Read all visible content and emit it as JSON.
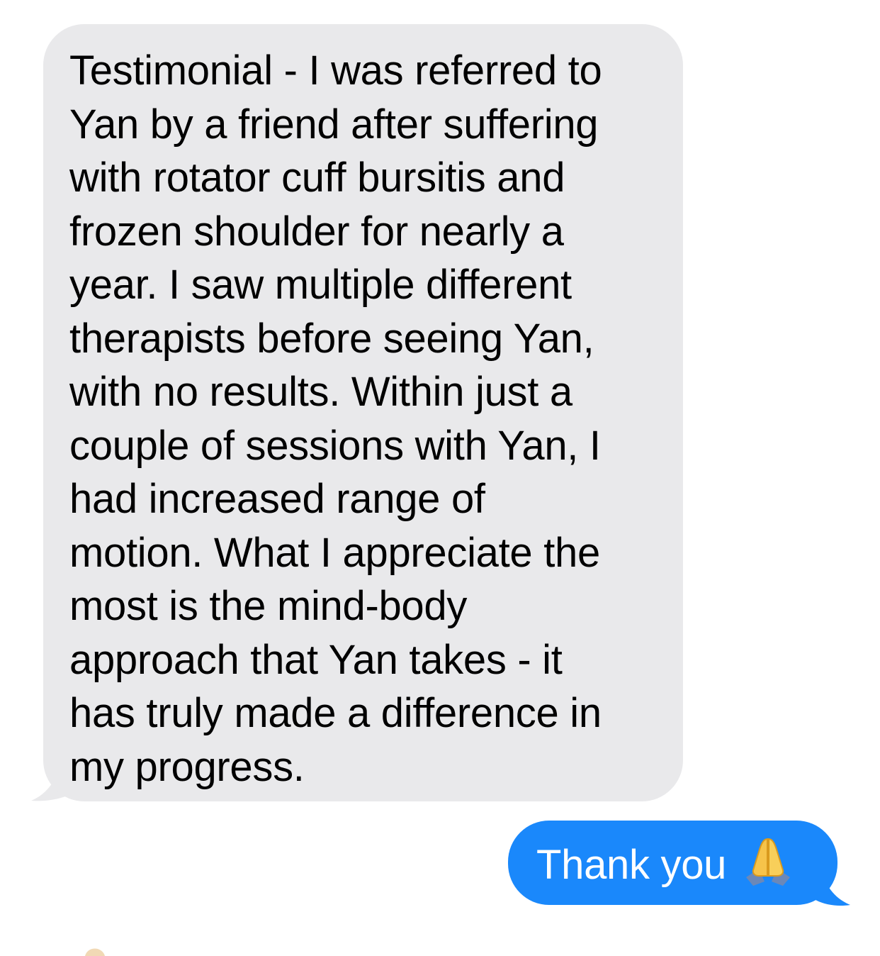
{
  "messages": {
    "incoming": {
      "text": "Testimonial -  I was referred to\nYan by a friend after suffering\nwith rotator cuff bursitis and\nfrozen shoulder for nearly a\nyear.  I saw multiple different\ntherapists before seeing Yan,\nwith no results.  Within just a\ncouple of sessions with Yan, I\nhad increased range of\nmotion.  What I appreciate the\nmost is the mind-body\napproach that Yan takes - it\nhas truly made a difference in\nmy progress.",
      "bubble_color": "#e9e9eb",
      "text_color": "#000000"
    },
    "outgoing": {
      "text": "Thank you",
      "emoji_icon": "folded-hands-icon",
      "bubble_color": "#1a88fb",
      "text_color": "#ffffff"
    }
  },
  "reaction_peek": {
    "icon": "emoji-peek-icon"
  }
}
